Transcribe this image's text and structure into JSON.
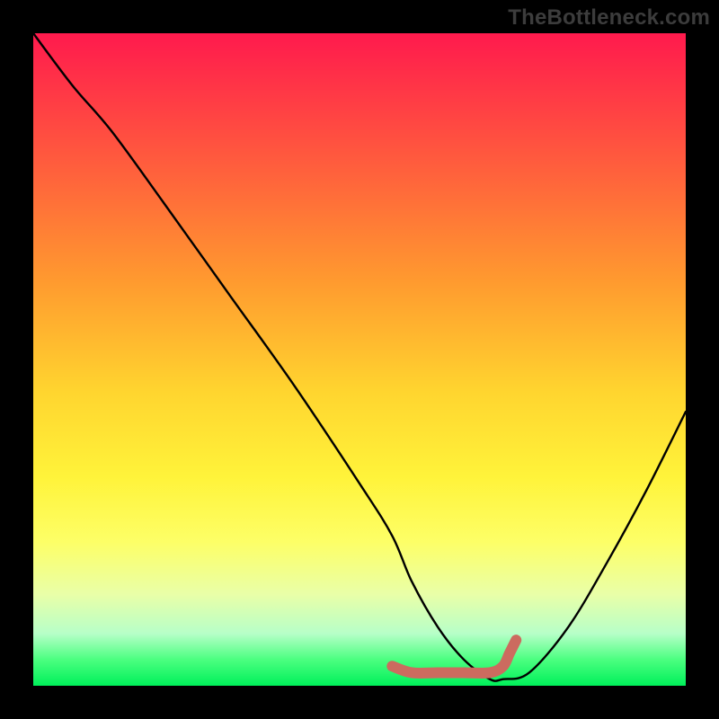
{
  "watermark": "TheBottleneck.com",
  "chart_data": {
    "type": "line",
    "title": "",
    "xlabel": "",
    "ylabel": "",
    "xlim": [
      0,
      100
    ],
    "ylim": [
      0,
      100
    ],
    "series": [
      {
        "name": "bottleneck-curve",
        "x": [
          0,
          6,
          12,
          20,
          30,
          40,
          50,
          55,
          58,
          62,
          66,
          70,
          72,
          76,
          82,
          88,
          94,
          100
        ],
        "y": [
          100,
          92,
          85,
          74,
          60,
          46,
          31,
          23,
          16,
          9,
          4,
          1,
          1,
          2,
          9,
          19,
          30,
          42
        ]
      },
      {
        "name": "optimal-band",
        "x": [
          55,
          58,
          62,
          66,
          70,
          72,
          73,
          74
        ],
        "y": [
          3,
          2,
          2,
          2,
          2,
          3,
          5,
          7
        ]
      }
    ],
    "colors": {
      "curve": "#000000",
      "band": "#cc6b5f"
    }
  }
}
